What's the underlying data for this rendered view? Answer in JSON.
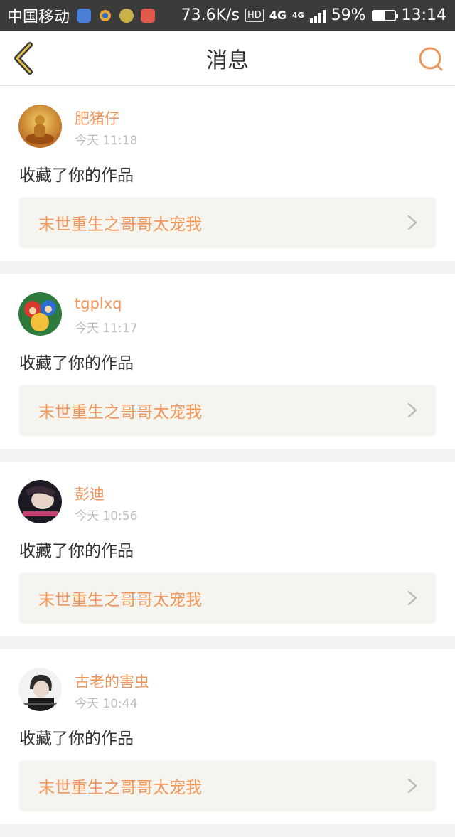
{
  "status_bar": {
    "carrier": "中国移动",
    "speed": "73.6K/s",
    "hd": "HD",
    "net_primary": "4G",
    "net_secondary": "4G",
    "battery": "59%",
    "battery_level": 0.59,
    "time": "13:14",
    "notif_icons": [
      "location-app-icon",
      "baidu-app-icon",
      "game-app-icon",
      "mail-app-icon"
    ]
  },
  "header": {
    "title": "消息",
    "back_icon": "chevron-left-icon",
    "search_icon": "search-icon",
    "accent_color": "#f0965a"
  },
  "messages": [
    {
      "user": "肥猪仔",
      "time": "今天 11:18",
      "action": "收藏了你的作品",
      "work": "末世重生之哥哥太宠我"
    },
    {
      "user": "tgplxq",
      "time": "今天 11:17",
      "action": "收藏了你的作品",
      "work": "末世重生之哥哥太宠我"
    },
    {
      "user": "彭迪",
      "time": "今天 10:56",
      "action": "收藏了你的作品",
      "work": "末世重生之哥哥太宠我"
    },
    {
      "user": "古老的害虫",
      "time": "今天 10:44",
      "action": "收藏了你的作品",
      "work": "末世重生之哥哥太宠我"
    }
  ]
}
